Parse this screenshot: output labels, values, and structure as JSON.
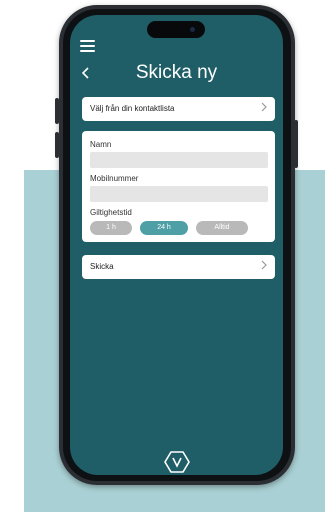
{
  "app": {
    "title": "Skicka ny"
  },
  "contacts_row": {
    "label": "Välj från din kontaktlista"
  },
  "form": {
    "name_label": "Namn",
    "name_value": "",
    "mobile_label": "Mobilnummer",
    "mobile_value": "",
    "validity_label": "Giltighetstid",
    "validity_options": [
      "1 h",
      "24 h",
      "Alltid"
    ],
    "validity_selected": "24 h"
  },
  "send_row": {
    "label": "Skicka"
  },
  "icons": {
    "menu": "hamburger-menu-icon",
    "back": "chevron-left-icon",
    "row_arrow": "chevron-right-icon",
    "logo": "hexagon-logo-icon"
  },
  "colors": {
    "screen_background": "#1f5e67",
    "backdrop": "#a9d0d4",
    "selected_pill": "#4f9fa6",
    "unselected_pill": "#b9b9b9",
    "field_background": "#e5e5e5"
  }
}
